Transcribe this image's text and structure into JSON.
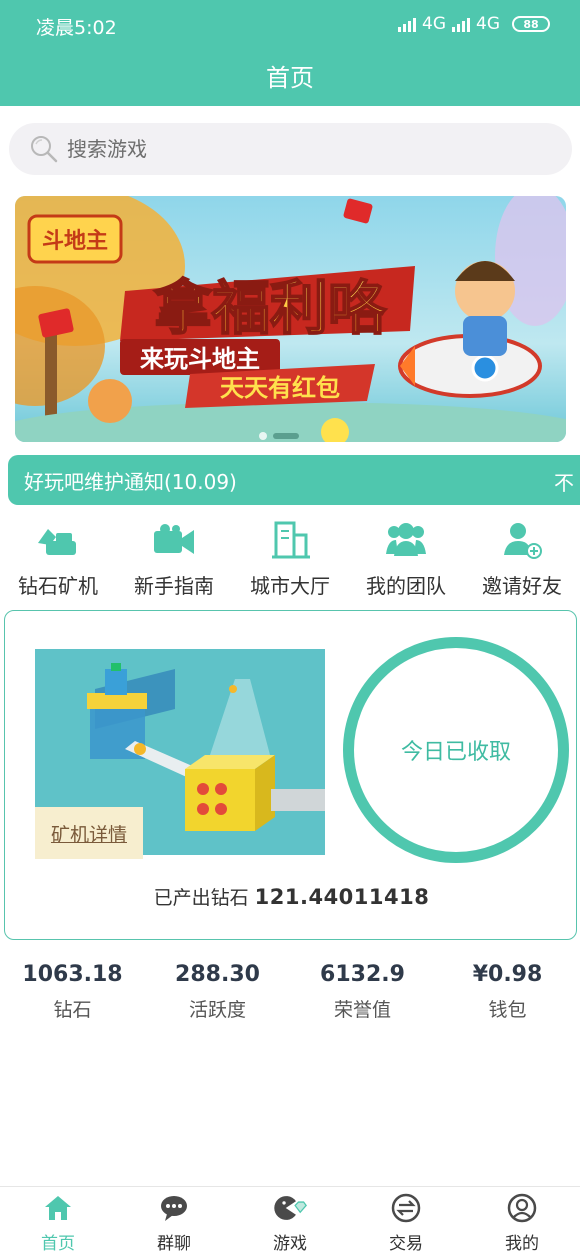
{
  "status_bar": {
    "time": "凌晨5:02",
    "network1": "4G",
    "network2": "4G",
    "battery": "88"
  },
  "header": {
    "title": "首页"
  },
  "search": {
    "placeholder": "搜索游戏"
  },
  "banner": {
    "logo": "斗地主",
    "headline": "拿福利咯",
    "subline": "来玩斗地主",
    "tagline": "天天有红包"
  },
  "notice": {
    "text": "好玩吧维护通知(10.09)",
    "next_text": "不"
  },
  "menu": {
    "items": [
      {
        "label": "钻石矿机",
        "icon": "mining-machine-icon"
      },
      {
        "label": "新手指南",
        "icon": "video-guide-icon"
      },
      {
        "label": "城市大厅",
        "icon": "city-building-icon"
      },
      {
        "label": "我的团队",
        "icon": "team-icon"
      },
      {
        "label": "邀请好友",
        "icon": "add-friend-icon"
      }
    ]
  },
  "mining": {
    "detail_label": "矿机详情",
    "collect_label": "今日已收取",
    "output_label": "已产出钻石",
    "output_value": "121.44011418"
  },
  "stats": [
    {
      "value": "1063.18",
      "label": "钻石"
    },
    {
      "value": "288.30",
      "label": "活跃度"
    },
    {
      "value": "6132.9",
      "label": "荣誉值"
    },
    {
      "value": "¥0.98",
      "label": "钱包"
    }
  ],
  "tabbar": {
    "items": [
      {
        "label": "首页",
        "icon": "home-icon",
        "active": true
      },
      {
        "label": "群聊",
        "icon": "chat-icon",
        "active": false
      },
      {
        "label": "游戏",
        "icon": "game-icon",
        "active": false
      },
      {
        "label": "交易",
        "icon": "exchange-icon",
        "active": false
      },
      {
        "label": "我的",
        "icon": "profile-icon",
        "active": false
      }
    ]
  },
  "colors": {
    "primary": "#4fc7ae",
    "text_dark": "#2f3a4a"
  }
}
